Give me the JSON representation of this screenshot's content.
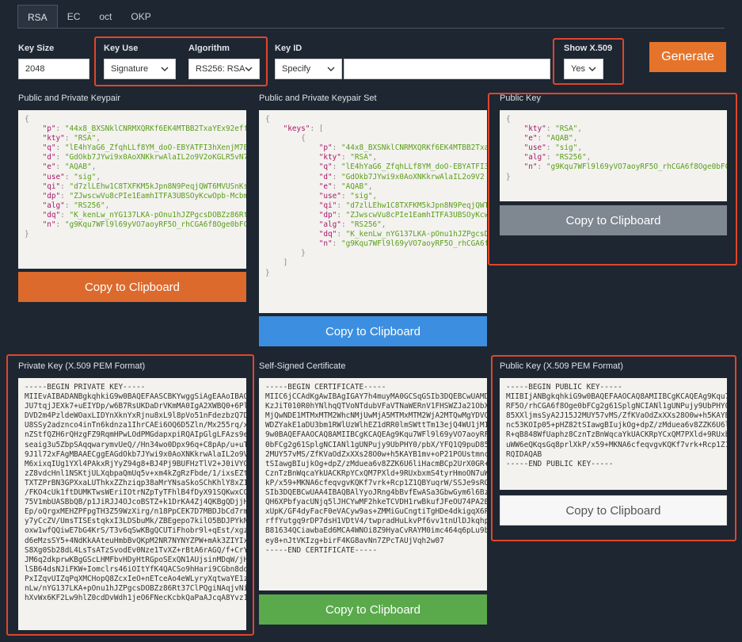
{
  "tabs": [
    {
      "label": "RSA",
      "active": true
    },
    {
      "label": "EC",
      "active": false
    },
    {
      "label": "oct",
      "active": false
    },
    {
      "label": "OKP",
      "active": false
    }
  ],
  "form": {
    "key_size_label": "Key Size",
    "key_size_value": "2048",
    "key_use_label": "Key Use",
    "key_use_value": "Signature",
    "algorithm_label": "Algorithm",
    "algorithm_value": "RS256: RSA",
    "key_id_label": "Key ID",
    "key_id_value": "Specify",
    "key_id_text": "",
    "show_x509_label": "Show X.509",
    "show_x509_value": "Yes",
    "generate_label": "Generate"
  },
  "panels": {
    "keypair": {
      "title": "Public and Private Keypair",
      "copy_label": "Copy to Clipboard",
      "lines": [
        "{",
        "    \"p\": \"44x8_BXSNklCNRMXQRKf6EK4MTBB2TxaYEx92eff",
        "    \"kty\": \"RSA\",",
        "    \"q\": \"lE4hYaG6_ZfqhLLf8YM_doO-EBYATFI3hXenjM7B",
        "    \"d\": \"GdOkb7JYwi9x0AoXNKkrwAlaIL2o9V2oKGLR5vN7",
        "    \"e\": \"AQAB\",",
        "    \"use\": \"sig\",",
        "    \"qi\": \"d7zlLEhw1C8TXFKM5kJpn8N9PeqjQWT6MVUSnKs",
        "    \"dp\": \"ZJwscwVu8cPIe1EamhITFA3UBSOyKcwOpb-Mcbm",
        "    \"alg\": \"RS256\",",
        "    \"dq\": \"K_kenLw_nYG137LKA-pOnu1hJZPgcsDOBZz86Rt",
        "    \"n\": \"g9Kqu7WFl9l69yVO7aoyRF5O_rhCGA6f8Oge0bFC",
        "}"
      ]
    },
    "keypair_set": {
      "title": "Public and Private Keypair Set",
      "copy_label": "Copy to Clipboard",
      "lines": [
        "{",
        "    \"keys\": [",
        "        {",
        "            \"p\": \"44x8_BXSNklCNRMXQRKf6EK4MTBB2TxaY",
        "            \"kty\": \"RSA\",",
        "            \"q\": \"lE4hYaG6_ZfqhLLf8YM_doO-EBYATFI3",
        "            \"d\": \"GdOkb7JYwi9x0AoXNKkrwAlaIL2o9V2",
        "            \"e\": \"AQAB\",",
        "            \"use\": \"sig\",",
        "            \"qi\": \"d7zlLEhw1C8TXFKM5kJpn8N9PeqjQWT6",
        "            \"dp\": \"ZJwscwVu8cPIe1EamhITFA3UBSOyKcw",
        "            \"alg\": \"RS256\",",
        "            \"dq\": \"K_kenLw_nYG137LKA-pOnu1hJZPgcsD",
        "            \"n\": \"g9Kqu7WFl9l69yVO7aoyRF5O_rhCGA6f",
        "        }",
        "    ]",
        "}"
      ]
    },
    "public_key": {
      "title": "Public Key",
      "copy_label": "Copy to Clipboard",
      "lines": [
        "{",
        "    \"kty\": \"RSA\",",
        "    \"e\": \"AQAB\",",
        "    \"use\": \"sig\",",
        "    \"alg\": \"RS256\",",
        "    \"n\": \"g9Kqu7WFl9l69yVO7aoyRF5O_rhCGA6f8Oge0bFC",
        "}"
      ]
    },
    "private_pem": {
      "title": "Private Key (X.509 PEM Format)",
      "lines": [
        "-----BEGIN PRIVATE KEY-----",
        "MIIEvAIBADANBgkqhkiG9w0BAQEFAASCBKYwggSiAgEAAoIBAQ",
        "JU7tqjJEXk7+uEIYDp/w6B7RsUKDaDrVKmMA0IgA2XWBQ0+6Pl",
        "DVD2m4PzldeWOaxLIDYnXknYxRjnu8xL9l8pVo51nFdezbzQ7D",
        "U8SSy2adznco4inTn6kdnza1IhrCAEi6OQ6D5Zln/Mx255rq/x",
        "nZStfQZH6rQHzgFZ9RqmHPwLOdPMGdapxpiRQAIpGlgLFAzs9e",
        "seaig3u5ZbpSAqqwarymvUeQ//Hn34wo0Dpx96q+C8pAp/u+uT",
        "9J1l72xFAgMBAAECggEAGdOkb7JYwi9x0AoXNKkrwAlaIL2o9V",
        "M6xixqIUg1YXl4PAkxRjYyZ94g8+BJ4Pj9BUFHzTlV2+J0iVYQ",
        "zZ8vdcHnl1NSKtjULXqbpaQmUq5v+xm4kZgRzFbde/1/ixsEZt",
        "TXTZPrBN3GPXxaLUThkxZZhziqp38aMrYNsaSkoSChKhlY8xZI",
        "/FKO4cUk1ftDUMKTwsWEriIOtrNZpTyTFhlB4fDyX91SQKwxCO",
        "75V1mbUASBbQB/p1JiRJJ4OJcoBSTZ+k1DrKA4Zj4QKBgQDjjH",
        "Ep/oQrgxMEHZPFpgTH3Z59WzXirg/n18PpCEK7D7MBDJbCd7rm",
        "y7yCcZV/UmsTISEstqkxI3LDSbuMk/ZBEgepo7kilO5BDJPYkN",
        "oxw1wfQQiwE7bG4KrS/T3v6qSwKBgQCUTiFhobr9l+qEst/xgz",
        "d6eMzsSY5+4NdKkAAteuHmbBvQKpM2NR7NYNYZPW+mAk3ZIYIx",
        "S8Xg0Sb28dL4LsTsATzSvodEv0Nze1TvXZ+rBtA6rAGQ/f+CrY",
        "JM6q2dkprwKBgGScLHMFbvHDyHtRGpoSExQN1AUjsinMDqW/jH",
        "lSB64dsNJiFKW+Iomclrs46iOItYfK4QACSo9hHari9CGbn8dd",
        "PxIZqvUIZqPqXMCHopQ8ZcxIeO+nETceAo4eWLyryXqtwaYE1z",
        "nLw/nYG137LKA+pOnu1hJZPgcsDOBZz86Rt37ClPQgiNAqjvNi",
        "hXvWx6KF2Lw9hlZ0cdDvWdh1jeO6FNecKcbkQaPaAJcqA8Yvz1"
      ]
    },
    "certificate": {
      "title": "Self-Signed Certificate",
      "copy_label": "Copy to Clipboard",
      "lines": [
        "-----BEGIN CERTIFICATE-----",
        "MIIC6jCCAdKgAwIBAgIGAY7h4muyMA0GCSqGSIb3DQEBCwUAMD",
        "KzJiT010R0hYNlhqQTVoNTdubVFaVTNaWERnV1FHSWZJa21ObX",
        "MjQwNDE1MTMxMTM2WhcNMjUwMjA5MTMxMTM2WjA2MTQwMgYDVQ",
        "WDZYakE1aDU3bm1RWlUzWlhEZ1dRR0lmSWttTm13ejQ4WU1jMI",
        "9w0BAQEFAAOCAQ8AMIIBCgKCAQEAg9Kqu7WFl9l69yVO7aoyRF",
        "0bFCg2g61SplgNCIANl1gUNPujy9UbPHY0/pbX/YFQ1Q9puD85",
        "2MUY57vMS/ZfKVaOdZxXXs28O0w+h5KAYB1mv+oP21POUstmnc",
        "tSIawgBIujkOg+dpZ/zMduea6v8ZZK6U6liHacmBCp2UrX0GR+",
        "CznTzBnWqcaYkUACKRpYCxQM7PXld+9RUxbxmS4tyrHmoON7uW",
        "kP/x59+MKNA6cfeqvgvKQKf7vrk+Rcp1Z1QBYuqrW/SSJe9sRQ",
        "SIb3DQEBCwUAA4IBAQBAlYyoJRng4bBvfEwASa3GbwGym6l6Bz",
        "QH6XPbfyacUNjq5lJHCYwMF2hkeTCVDH1rwBkufJFeOU74PA2B",
        "xUpK/GF4dyFacF0eVACyw9as+ZMMiGuCngtiTgHDe4dkigqX6P",
        "rffYutgq9rDP7dsH1VDtV4/twpradHuLkvPf6vv1tnUlDJkqhp",
        "B81634QCiawbaEd6MCA4WNOi8Z9HyaCvRAYM0imc464q6pLu9b",
        "ey8+nJtVKIzg+birF4KG8avNn7ZPcTAUjVqh2w07",
        "-----END CERTIFICATE-----"
      ]
    },
    "public_pem": {
      "title": "Public Key (X.509 PEM Format)",
      "copy_label": "Copy to Clipboard",
      "lines": [
        "-----BEGIN PUBLIC KEY-----",
        "MIIBIjANBgkqhkiG9w0BAQEFAAOCAQ8AMIIBCgKCAQEAg9Kqu7",
        "RF5O/rhCGA6f8Oge0bFCg2g61SplgNCIANl1gUNPujy9UbPHY0",
        "85XXljmsSyA2J15J2MUY57vMS/ZfKVaOdZxXXs28O0w+h5KAYB",
        "nc53KOIp05+pHZ82tSIawgBIujkOg+dpZ/zMduea6v8ZZK6U6l",
        "R+qB848WfUaphz8CznTzBnWqcaYkUACKRpYCxQM7PXld+9RUxb",
        "uWW6eQKqsGq8prlXkP/x59+MKNA6cfeqvgvKQKf7vrk+Rcp1Z1",
        "RQIDAQAB",
        "-----END PUBLIC KEY-----"
      ]
    }
  },
  "colors": {
    "background": "#1e2632",
    "accent_orange": "#e5742a",
    "highlight_red": "#e0462b",
    "copy_blue": "#3c8fe0",
    "copy_gray": "#7f8791",
    "copy_green": "#5aaa4c"
  }
}
